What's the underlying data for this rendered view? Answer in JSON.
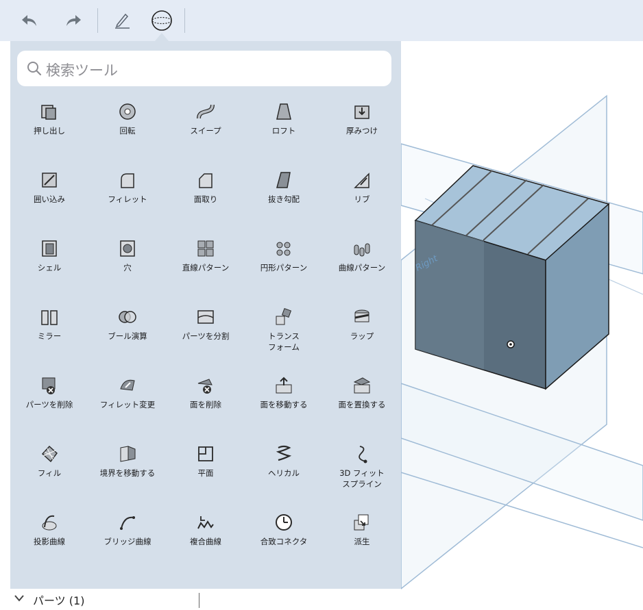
{
  "search": {
    "placeholder": "検索ツール"
  },
  "tools": [
    {
      "label": "押し出し",
      "icon": "extrude-icon"
    },
    {
      "label": "回転",
      "icon": "revolve-icon"
    },
    {
      "label": "スイープ",
      "icon": "sweep-icon"
    },
    {
      "label": "ロフト",
      "icon": "loft-icon"
    },
    {
      "label": "厚みつけ",
      "icon": "thicken-icon"
    },
    {
      "label": "囲い込み",
      "icon": "enclose-icon"
    },
    {
      "label": "フィレット",
      "icon": "fillet-icon"
    },
    {
      "label": "面取り",
      "icon": "chamfer-icon"
    },
    {
      "label": "抜き勾配",
      "icon": "draft-icon"
    },
    {
      "label": "リブ",
      "icon": "rib-icon"
    },
    {
      "label": "シェル",
      "icon": "shell-icon"
    },
    {
      "label": "穴",
      "icon": "hole-icon"
    },
    {
      "label": "直線パターン",
      "icon": "linear-pattern-icon"
    },
    {
      "label": "円形パターン",
      "icon": "circular-pattern-icon"
    },
    {
      "label": "曲線パターン",
      "icon": "curve-pattern-icon"
    },
    {
      "label": "ミラー",
      "icon": "mirror-icon"
    },
    {
      "label": "ブール演算",
      "icon": "boolean-icon"
    },
    {
      "label": "パーツを分割",
      "icon": "split-part-icon"
    },
    {
      "label": "トランス\nフォーム",
      "icon": "transform-icon"
    },
    {
      "label": "ラップ",
      "icon": "wrap-icon"
    },
    {
      "label": "パーツを削除",
      "icon": "delete-part-icon"
    },
    {
      "label": "フィレット変更",
      "icon": "modify-fillet-icon"
    },
    {
      "label": "面を削除",
      "icon": "delete-face-icon"
    },
    {
      "label": "面を移動する",
      "icon": "move-face-icon"
    },
    {
      "label": "面を置換する",
      "icon": "replace-face-icon"
    },
    {
      "label": "フィル",
      "icon": "fill-icon"
    },
    {
      "label": "境界を移動する",
      "icon": "move-boundary-icon"
    },
    {
      "label": "平面",
      "icon": "plane-icon"
    },
    {
      "label": "ヘリカル",
      "icon": "helix-icon"
    },
    {
      "label": "3D フィット\nスプライン",
      "icon": "fit-spline-icon"
    },
    {
      "label": "投影曲線",
      "icon": "projected-curve-icon"
    },
    {
      "label": "ブリッジ曲線",
      "icon": "bridging-curve-icon"
    },
    {
      "label": "複合曲線",
      "icon": "composite-curve-icon"
    },
    {
      "label": "合致コネクタ",
      "icon": "mate-connector-icon"
    },
    {
      "label": "派生",
      "icon": "derived-icon"
    }
  ],
  "parts": {
    "label": "パーツ (1)"
  },
  "viewport": {
    "plane_label": "Right"
  },
  "colors": {
    "toolbar_bg": "#e4ebf5",
    "panel_bg": "#d5dfea",
    "plane_stroke": "#9fbbd6",
    "cube_top": "#a7c3d9",
    "cube_front": "#5a6e7e",
    "cube_side": "#7f9db4"
  }
}
